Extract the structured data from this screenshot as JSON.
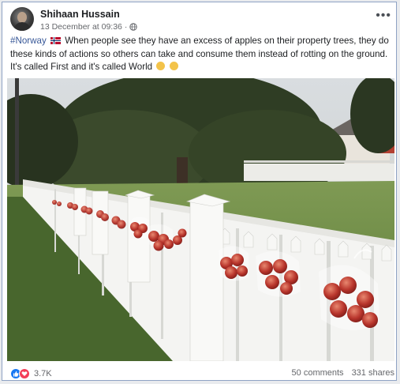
{
  "post": {
    "author": "Shihaan Hussain",
    "date": "13 December at 09:36",
    "separator": "·",
    "privacy_icon": "globe-icon",
    "more_icon": "more-options-icon",
    "more_label": "•••",
    "hashtag": "#Norway",
    "flag_icon": "norway-flag-icon",
    "text": "When people see they have an excess of apples on their property trees, they do these kinds of actions so others can take and consume them instead of rotting on the ground. It's called First and it's called World",
    "emojis": [
      "ok-hand-emoji",
      "clap-emoji"
    ]
  },
  "footer": {
    "reaction_icons": [
      "like-icon",
      "love-icon"
    ],
    "reactions": "3.7K",
    "comments": "50 comments",
    "shares": "331 shares"
  },
  "colors": {
    "link": "#385898",
    "like": "#1877f2",
    "love": "#f33e58",
    "frame_border": "#8fa3c4"
  }
}
